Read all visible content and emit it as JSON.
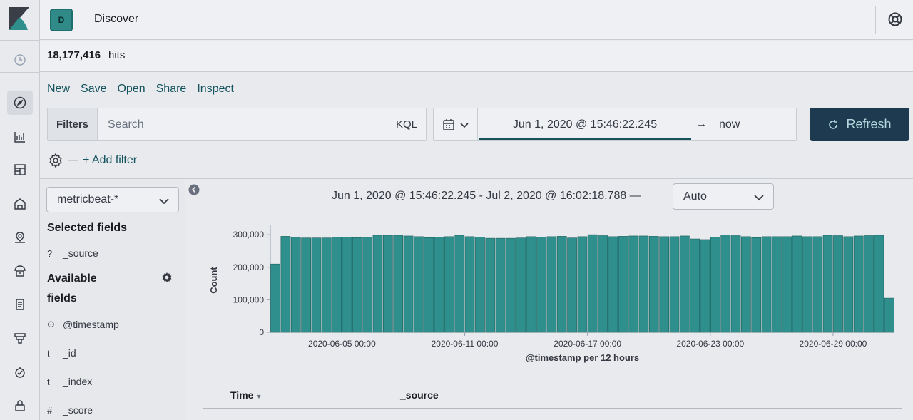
{
  "header": {
    "space_initial": "D",
    "app_title": "Discover"
  },
  "hits": {
    "count": "18,177,416",
    "label": "hits"
  },
  "topnav": [
    "New",
    "Save",
    "Open",
    "Share",
    "Inspect"
  ],
  "querybar": {
    "filters_label": "Filters",
    "search_placeholder": "Search",
    "search_value": "",
    "language": "KQL"
  },
  "datepicker": {
    "start": "Jun 1, 2020 @ 15:46:22.245",
    "arrow": "→",
    "end": "now"
  },
  "refresh_label": "Refresh",
  "add_filter_label": "+ Add filter",
  "sidebar": {
    "index_pattern": "metricbeat-*",
    "selected_heading": "Selected fields",
    "selected_fields": [
      {
        "type": "?",
        "name": "_source"
      }
    ],
    "available_heading_line1": "Available",
    "available_heading_line2": "fields",
    "available_fields": [
      {
        "type": "⊙",
        "name": "@timestamp"
      },
      {
        "type": "t",
        "name": "_id"
      },
      {
        "type": "t",
        "name": "_index"
      },
      {
        "type": "#",
        "name": "_score"
      }
    ]
  },
  "histogram_header": {
    "range_label": "Jun 1, 2020 @ 15:46:22.245 - Jul 2, 2020 @ 16:02:18.788 —",
    "interval": "Auto"
  },
  "table": {
    "time_header": "Time",
    "source_header": "_source"
  },
  "colors": {
    "accent": "#12535e",
    "bar": "#2f8f8c",
    "bar_edge": "#1d5f5d",
    "refresh_bg": "#1d3a50"
  },
  "chart_data": {
    "type": "bar",
    "title": "",
    "xlabel": "@timestamp per 12 hours",
    "ylabel": "Count",
    "ylim": [
      0,
      320000
    ],
    "yticks": [
      0,
      100000,
      200000,
      300000
    ],
    "ytick_labels": [
      "0",
      "100,000",
      "200,000",
      "300,000"
    ],
    "xtick_labels": [
      "2020-06-05 00:00",
      "2020-06-11 00:00",
      "2020-06-17 00:00",
      "2020-06-23 00:00",
      "2020-06-29 00:00"
    ],
    "xtick_bucket_index": [
      7,
      19,
      31,
      43,
      55
    ],
    "values": [
      210000,
      295000,
      292000,
      290000,
      290000,
      290000,
      293000,
      293000,
      291000,
      292000,
      298000,
      298000,
      298000,
      296000,
      294000,
      291000,
      293000,
      294000,
      298000,
      294000,
      293000,
      289000,
      289000,
      289000,
      290000,
      294000,
      293000,
      294000,
      295000,
      290000,
      294000,
      300000,
      297000,
      294000,
      295000,
      296000,
      296000,
      295000,
      294000,
      294000,
      296000,
      287000,
      285000,
      293000,
      299000,
      297000,
      294000,
      291000,
      294000,
      294000,
      294000,
      296000,
      294000,
      294000,
      298000,
      297000,
      294000,
      296000,
      297000,
      298000,
      105000
    ]
  }
}
